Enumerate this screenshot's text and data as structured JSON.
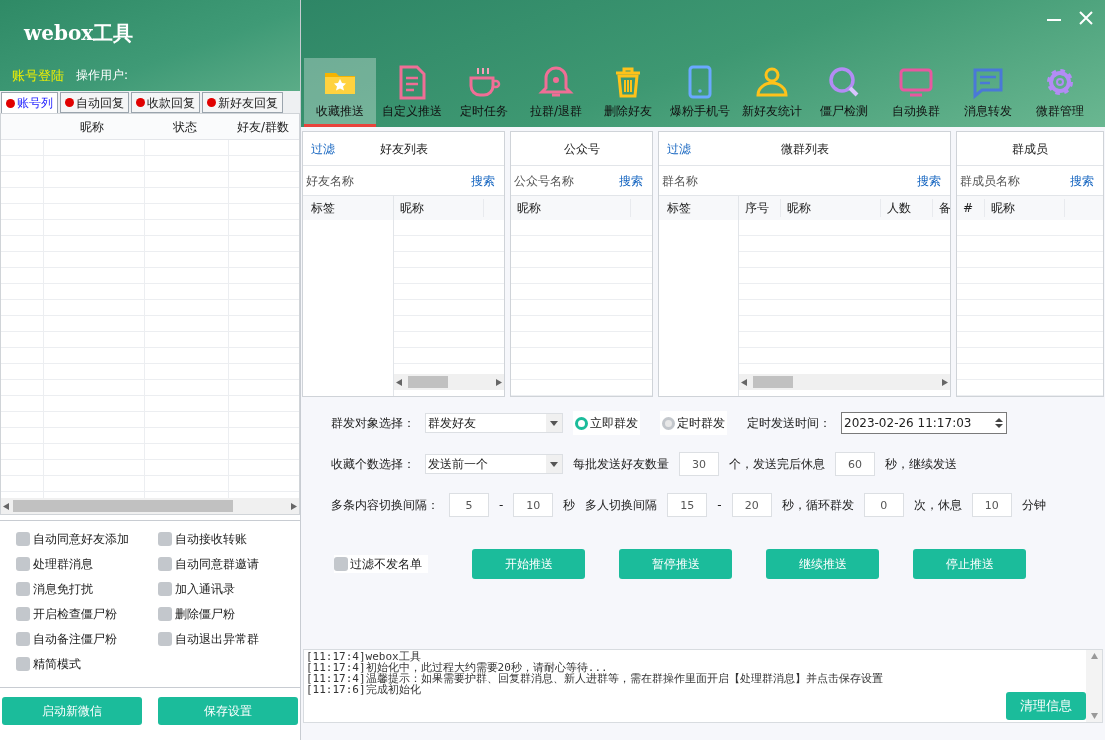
{
  "window": {
    "title": "webox工具"
  },
  "account": {
    "login_label": "账号登陆",
    "operator_label": "操作用户:"
  },
  "left_tabs": [
    {
      "label": "账号列",
      "selected": true
    },
    {
      "label": "自动回复",
      "selected": false
    },
    {
      "label": "收款回复",
      "selected": false
    },
    {
      "label": "新好友回复",
      "selected": false
    }
  ],
  "account_table": {
    "columns": [
      "昵称",
      "状态",
      "好友/群数"
    ]
  },
  "options": [
    {
      "label": "自动同意好友添加",
      "checked": false
    },
    {
      "label": "自动接收转账",
      "checked": false
    },
    {
      "label": "处理群消息",
      "checked": false
    },
    {
      "label": "自动同意群邀请",
      "checked": false
    },
    {
      "label": "消息免打扰",
      "checked": false
    },
    {
      "label": "加入通讯录",
      "checked": false
    },
    {
      "label": "开启检查僵尸粉",
      "checked": false
    },
    {
      "label": "删除僵尸粉",
      "checked": false
    },
    {
      "label": "自动备注僵尸粉",
      "checked": false
    },
    {
      "label": "自动退出异常群",
      "checked": false
    },
    {
      "label": "精简模式",
      "checked": false
    }
  ],
  "left_buttons": [
    "启动新微信",
    "保存设置"
  ],
  "toolbar": [
    {
      "label": "收藏推送",
      "selected": true
    },
    {
      "label": "自定义推送",
      "selected": false
    },
    {
      "label": "定时任务",
      "selected": false
    },
    {
      "label": "拉群/退群",
      "selected": false
    },
    {
      "label": "删除好友",
      "selected": false
    },
    {
      "label": "爆粉手机号",
      "selected": false
    },
    {
      "label": "新好友统计",
      "selected": false
    },
    {
      "label": "僵尸检测",
      "selected": false
    },
    {
      "label": "自动换群",
      "selected": false
    },
    {
      "label": "消息转发",
      "selected": false
    },
    {
      "label": "微群管理",
      "selected": false
    }
  ],
  "panels": [
    {
      "filter": "过滤",
      "title": "好友列表",
      "search_placeholder": "好友名称",
      "search_button": "搜索",
      "fixed_columns": [
        "标签"
      ],
      "columns": [
        "昵称"
      ]
    },
    {
      "title": "公众号",
      "search_placeholder": "公众号名称",
      "search_button": "搜索",
      "columns": [
        "昵称"
      ]
    },
    {
      "filter": "过滤",
      "title": "微群列表",
      "search_placeholder": "群名称",
      "search_button": "搜索",
      "fixed_columns": [
        "标签"
      ],
      "columns": [
        "序号",
        "昵称",
        "人数",
        "备"
      ]
    },
    {
      "title": "群成员",
      "search_placeholder": "群成员名称",
      "search_button": "搜索",
      "columns": [
        "#",
        "昵称"
      ]
    }
  ],
  "form": {
    "lines": [
      {
        "items": [
          {
            "kind": "label",
            "text": "群发对象选择："
          },
          {
            "kind": "select",
            "value": "群发好友"
          },
          {
            "kind": "radio",
            "label": "立即群发",
            "selected": true
          },
          {
            "kind": "radio",
            "label": "定时群发",
            "selected": false
          },
          {
            "kind": "label",
            "text": "定时发送时间："
          },
          {
            "kind": "datetime",
            "value": "2023-02-26 11:17:03"
          }
        ]
      },
      {
        "items": [
          {
            "kind": "label",
            "text": "收藏个数选择："
          },
          {
            "kind": "select",
            "value": "发送前一个"
          },
          {
            "kind": "label",
            "text": "每批发送好友数量"
          },
          {
            "kind": "input",
            "value": "30"
          },
          {
            "kind": "label",
            "text": "个，发送完后休息"
          },
          {
            "kind": "input",
            "value": "60"
          },
          {
            "kind": "label",
            "text": "秒，继续发送"
          }
        ]
      },
      {
        "items": [
          {
            "kind": "label",
            "text": "多条内容切换间隔："
          },
          {
            "kind": "input",
            "value": "5"
          },
          {
            "kind": "label",
            "text": "-"
          },
          {
            "kind": "input",
            "value": "10"
          },
          {
            "kind": "label",
            "text": "秒"
          },
          {
            "kind": "label",
            "text": "多人切换间隔"
          },
          {
            "kind": "input",
            "value": "15"
          },
          {
            "kind": "label",
            "text": "-"
          },
          {
            "kind": "input",
            "value": "20"
          },
          {
            "kind": "label",
            "text": "秒，循环群发"
          },
          {
            "kind": "input",
            "value": "0"
          },
          {
            "kind": "label",
            "text": "次，休息"
          },
          {
            "kind": "input",
            "value": "10"
          },
          {
            "kind": "label",
            "text": "分钟"
          }
        ]
      }
    ]
  },
  "filter_checkbox": {
    "label": "过滤不发名单",
    "checked": false
  },
  "actions": [
    "开始推送",
    "暂停推送",
    "继续推送",
    "停止推送"
  ],
  "log": {
    "lines": [
      "[11:17:4]webox工具",
      "[11:17:4]初始化中，此过程大约需要20秒，请耐心等待...",
      "[11:17:4]温馨提示：如果需要护群、回复群消息、新人进群等，需在群操作里面开启【处理群消息】并点击保存设置",
      "[11:17:6]完成初始化"
    ],
    "clear_button": "清理信息"
  }
}
